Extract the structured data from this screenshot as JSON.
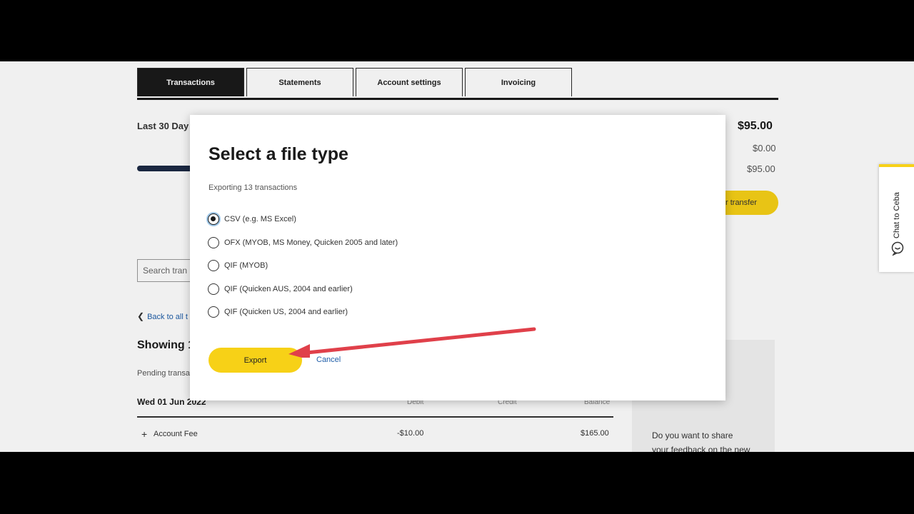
{
  "tabs": [
    {
      "label": "Transactions",
      "active": true
    },
    {
      "label": "Statements",
      "active": false
    },
    {
      "label": "Account settings",
      "active": false
    },
    {
      "label": "Invoicing",
      "active": false
    }
  ],
  "background": {
    "period_label": "Last 30 Day",
    "amount_total": "$95.00",
    "amount_zero": "$0.00",
    "amount_available": "$95.00",
    "transfer_button": "r transfer",
    "search_placeholder": "Search tran",
    "back_link": "Back to all t",
    "showing_label": "Showing 1",
    "pending_label": "Pending transa",
    "date_header": "Wed 01 Jun 2022",
    "col_debit": "Debit",
    "col_credit": "Credit",
    "col_balance": "Balance",
    "row": {
      "name": "Account Fee",
      "debit": "-$10.00",
      "balance": "$165.00"
    },
    "feedback_line1": "Do you want to share",
    "feedback_line2": "your feedback on the new"
  },
  "chat": {
    "label": "Chat to Ceba",
    "icon": "chat-bubble-icon"
  },
  "modal": {
    "title": "Select a file type",
    "subtitle": "Exporting 13 transactions",
    "options": [
      {
        "label": "CSV (e.g. MS Excel)",
        "checked": true
      },
      {
        "label": "OFX (MYOB, MS Money, Quicken 2005 and later)",
        "checked": false
      },
      {
        "label": "QIF (MYOB)",
        "checked": false
      },
      {
        "label": "QIF (Quicken AUS, 2004 and earlier)",
        "checked": false
      },
      {
        "label": "QIF (Quicken US, 2004 and earlier)",
        "checked": false
      }
    ],
    "export_label": "Export",
    "cancel_label": "Cancel"
  },
  "colors": {
    "accent_yellow": "#f7d117",
    "dark": "#1a1a1a",
    "link": "#1f5ea8",
    "arrow": "#e0404a"
  }
}
